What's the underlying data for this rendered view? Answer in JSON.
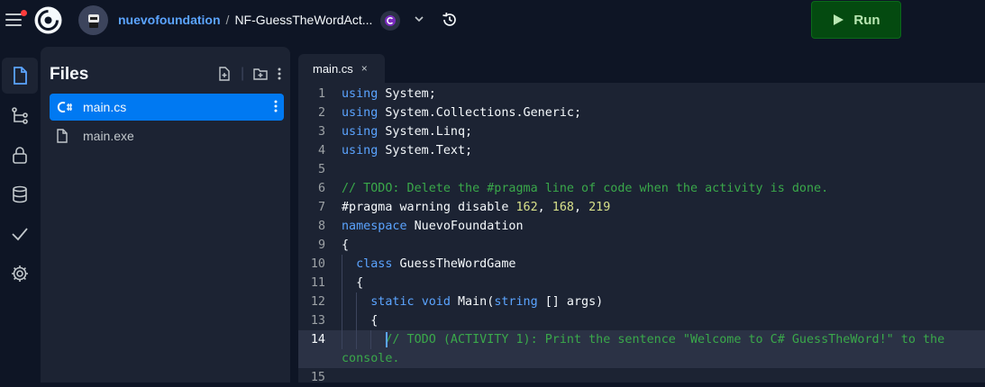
{
  "header": {
    "owner": "nuevofoundation",
    "separator": "/",
    "repl_name": "NF-GuessTheWordAct...",
    "run_label": "Run"
  },
  "files_panel": {
    "title": "Files",
    "files": [
      {
        "name": "main.cs",
        "icon": "csharp-file-icon",
        "selected": true
      },
      {
        "name": "main.exe",
        "icon": "file-icon",
        "selected": false
      }
    ]
  },
  "editor": {
    "tab_label": "main.cs",
    "tab_close": "×",
    "lines": [
      {
        "n": "1",
        "segs": [
          [
            "kw",
            "using"
          ],
          [
            "",
            "System;"
          ]
        ]
      },
      {
        "n": "2",
        "segs": [
          [
            "kw",
            "using"
          ],
          [
            "",
            "System.Collections.Generic;"
          ]
        ]
      },
      {
        "n": "3",
        "segs": [
          [
            "kw",
            "using"
          ],
          [
            "",
            "System.Linq;"
          ]
        ]
      },
      {
        "n": "4",
        "segs": [
          [
            "kw",
            "using"
          ],
          [
            "",
            "System.Text;"
          ]
        ]
      },
      {
        "n": "5",
        "segs": []
      },
      {
        "n": "6",
        "segs": [
          [
            "cm",
            "// TODO: Delete the #pragma line of code when the activity is done."
          ]
        ]
      },
      {
        "n": "7",
        "segs": [
          [
            "",
            "#pragma warning disable "
          ],
          [
            "num",
            "162"
          ],
          [
            "",
            ", "
          ],
          [
            "num",
            "168"
          ],
          [
            "",
            ", "
          ],
          [
            "num",
            "219"
          ]
        ]
      },
      {
        "n": "8",
        "segs": [
          [
            "kw",
            "namespace"
          ],
          [
            "",
            "NuevoFoundation"
          ]
        ]
      },
      {
        "n": "9",
        "segs": [
          [
            "",
            "{"
          ]
        ]
      },
      {
        "n": "10",
        "segs": [
          [
            "",
            "  "
          ],
          [
            "kw",
            "class"
          ],
          [
            "",
            "GuessTheWordGame"
          ]
        ]
      },
      {
        "n": "11",
        "segs": [
          [
            "",
            "  {"
          ]
        ]
      },
      {
        "n": "12",
        "segs": [
          [
            "",
            "    "
          ],
          [
            "kw",
            "static"
          ],
          [
            "",
            ""
          ],
          [
            "kw",
            "void"
          ],
          [
            "",
            "Main("
          ],
          [
            "kw",
            "string"
          ],
          [
            "",
            "[] args)"
          ]
        ]
      },
      {
        "n": "13",
        "segs": [
          [
            "",
            "    {"
          ]
        ]
      },
      {
        "n": "14",
        "segs": [
          [
            "",
            "      "
          ],
          [
            "cm",
            "// TODO (ACTIVITY 1): Print the sentence \"Welcome to C# GuessTheWord!\" to the"
          ]
        ]
      },
      {
        "n": "",
        "segs": [
          [
            "cm",
            "console."
          ]
        ]
      },
      {
        "n": "15",
        "segs": []
      }
    ]
  },
  "icons": {
    "menu": "hamburger-menu-icon",
    "logo": "replit-logo-icon",
    "history": "history-icon",
    "run": "play-icon"
  },
  "colors": {
    "background": "#0e1525",
    "panel": "#1c2333",
    "accent": "#0079f2",
    "keyword": "#5ba4ff",
    "comment": "#3aa84a",
    "number": "#d8e08a",
    "run_button": "#044a10"
  }
}
